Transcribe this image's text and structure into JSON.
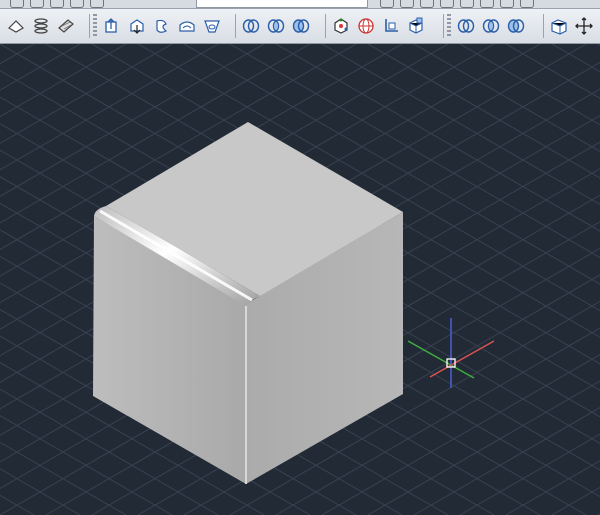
{
  "colors": {
    "viewport_bg": "#222a36",
    "grid_line": "#3a4352",
    "axis_x": "#d9534f",
    "axis_y": "#4caf50",
    "axis_z": "#4a5fd8",
    "cube_top": "#c9c9c9",
    "cube_left": "#b4b4b4",
    "cube_right": "#a9a9a9",
    "toolbar_bg": "#e4e8ee"
  },
  "toolbar": {
    "groups": [
      {
        "id": "modeling",
        "icons": [
          "section-plane-icon",
          "spring-icon",
          "surface-icon"
        ]
      },
      {
        "id": "solid-edit",
        "icons": [
          "extrude-faces-icon",
          "move-faces-icon",
          "offset-faces-icon",
          "shell-icon",
          "taper-faces-icon"
        ]
      },
      {
        "id": "boolean",
        "icons": [
          "union-icon",
          "intersect-icon",
          "subtract-icon"
        ]
      },
      {
        "id": "view",
        "icons": [
          "orbit-icon",
          "visual-style-icon",
          "ucs-icon",
          "view-cube-icon"
        ]
      },
      {
        "id": "boolean-2",
        "icons": [
          "union-icon",
          "intersect-icon",
          "subtract-icon"
        ]
      },
      {
        "id": "misc",
        "icons": [
          "box-icon",
          "move-gizmo-icon"
        ]
      }
    ]
  },
  "viewport": {
    "object": "filleted-cube",
    "ucs_gizmo": "ucs-crosshair-icon"
  }
}
